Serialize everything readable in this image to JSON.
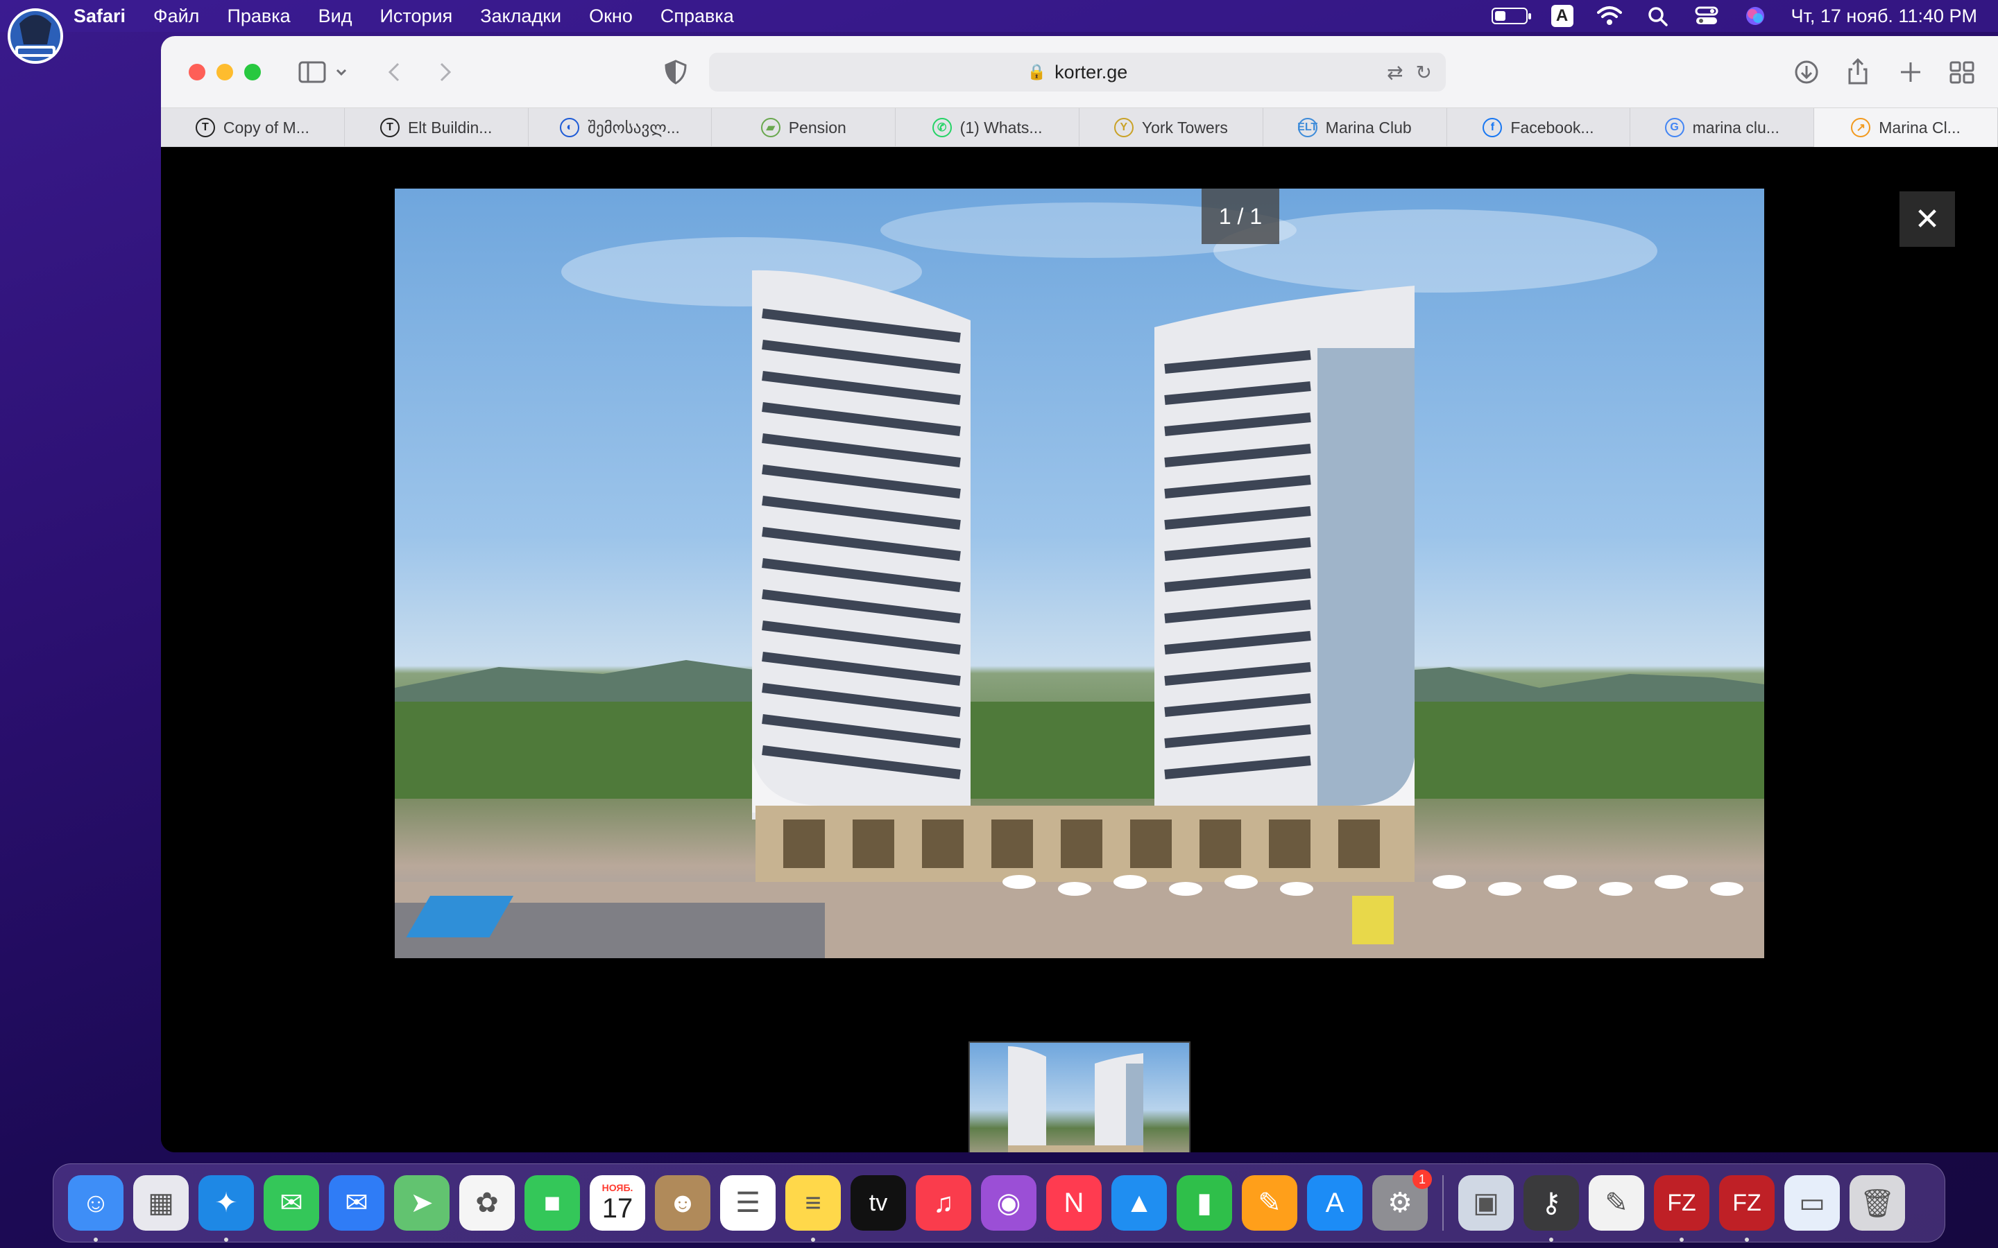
{
  "menubar": {
    "app_name": "Safari",
    "items": [
      "Файл",
      "Правка",
      "Вид",
      "История",
      "Закладки",
      "Окно",
      "Справка"
    ],
    "keyboard_layout": "A",
    "clock": "Чт, 17 нояб.  11:40 PM",
    "battery_level": 0.35
  },
  "browser": {
    "url": "korter.ge",
    "tabs": [
      {
        "label": "Copy of M...",
        "icon": "T",
        "icon_color": "#222222"
      },
      {
        "label": "Elt Buildin...",
        "icon": "T",
        "icon_color": "#222222"
      },
      {
        "label": "შემოსავლ...",
        "icon": "◐",
        "icon_color": "#1e5bd6"
      },
      {
        "label": "Pension",
        "icon": "▰",
        "icon_color": "#6aa84f"
      },
      {
        "label": "(1) Whats...",
        "icon": "✆",
        "icon_color": "#25d366"
      },
      {
        "label": "York Towers",
        "icon": "Y",
        "icon_color": "#c9a227"
      },
      {
        "label": "Marina Club",
        "icon": "ELT",
        "icon_color": "#3d8bd9"
      },
      {
        "label": "Facebook...",
        "icon": "f",
        "icon_color": "#1877f2"
      },
      {
        "label": "marina clu...",
        "icon": "G",
        "icon_color": "#4285f4"
      },
      {
        "label": "Marina Cl...",
        "icon": "↗",
        "icon_color": "#f29a1f"
      }
    ]
  },
  "lightbox": {
    "counter": "1 / 1",
    "close_glyph": "✕"
  },
  "dock": {
    "calendar_month": "НОЯБ.",
    "calendar_day": "17",
    "settings_badge": "1",
    "apps": [
      {
        "name": "finder-icon",
        "color": "#3e8ef7",
        "glyph": "☺"
      },
      {
        "name": "launchpad-icon",
        "color": "#e8e8ee",
        "glyph": "▦"
      },
      {
        "name": "safari-icon",
        "color": "#1e88e5",
        "glyph": "✦"
      },
      {
        "name": "messages-icon",
        "color": "#34c759",
        "glyph": "✉"
      },
      {
        "name": "mail-icon",
        "color": "#2f7cf6",
        "glyph": "✉"
      },
      {
        "name": "maps-icon",
        "color": "#62c370",
        "glyph": "➤"
      },
      {
        "name": "photos-icon",
        "color": "#f5f5f5",
        "glyph": "✿"
      },
      {
        "name": "facetime-icon",
        "color": "#34c759",
        "glyph": "■"
      },
      {
        "name": "calendar-icon",
        "color": "#ffffff",
        "glyph": ""
      },
      {
        "name": "contacts-icon",
        "color": "#b08a5a",
        "glyph": "☻"
      },
      {
        "name": "reminders-icon",
        "color": "#ffffff",
        "glyph": "☰"
      },
      {
        "name": "notes-icon",
        "color": "#ffd84a",
        "glyph": "≡"
      },
      {
        "name": "apple-tv-icon",
        "color": "#111111",
        "glyph": "tv"
      },
      {
        "name": "music-icon",
        "color": "#fa3c4c",
        "glyph": "♫"
      },
      {
        "name": "podcasts-icon",
        "color": "#9b4fd6",
        "glyph": "◉"
      },
      {
        "name": "news-icon",
        "color": "#ff3b50",
        "glyph": "N"
      },
      {
        "name": "keynote-icon",
        "color": "#1f8ef1",
        "glyph": "▲"
      },
      {
        "name": "numbers-icon",
        "color": "#2fbf4a",
        "glyph": "▮"
      },
      {
        "name": "pages-icon",
        "color": "#ff9f1a",
        "glyph": "✎"
      },
      {
        "name": "app-store-icon",
        "color": "#1c8cf6",
        "glyph": "A"
      },
      {
        "name": "system-settings-icon",
        "color": "#8e8e93",
        "glyph": "⚙"
      }
    ],
    "extra_apps": [
      {
        "name": "preview-icon",
        "color": "#d0d8e4",
        "glyph": "▣"
      },
      {
        "name": "keychain-icon",
        "color": "#3a3a3c",
        "glyph": "⚷"
      },
      {
        "name": "textedit-icon",
        "color": "#f2f2f2",
        "glyph": "✎"
      },
      {
        "name": "filezilla-icon",
        "color": "#bf2026",
        "glyph": "FZ"
      },
      {
        "name": "filezilla-recent-icon",
        "color": "#bf2026",
        "glyph": "FZ"
      },
      {
        "name": "window-preview-icon",
        "color": "#e6eefa",
        "glyph": "▭"
      },
      {
        "name": "trash-icon",
        "color": "#d8d8dc",
        "glyph": "🗑"
      }
    ]
  }
}
